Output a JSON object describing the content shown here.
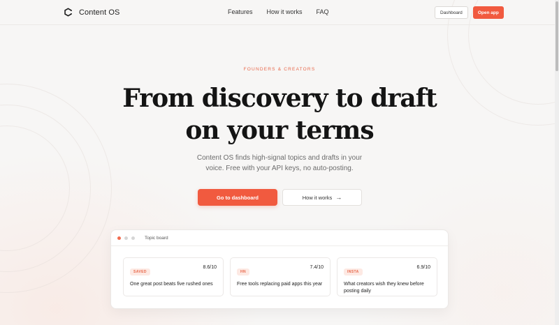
{
  "header": {
    "brand": "Content OS",
    "nav": [
      "Features",
      "How it works",
      "FAQ"
    ],
    "dashboard_label": "Dashboard",
    "open_app_label": "Open app"
  },
  "hero": {
    "eyebrow": "FOUNDERS & CREATORS",
    "headline_line1": "From discovery to draft",
    "headline_line2": "on your terms",
    "subtitle": "Content OS finds high-signal topics and drafts in your voice. Free with your API keys, no auto-posting.",
    "cta_primary": "Go to dashboard",
    "cta_secondary": "How it works",
    "cta_secondary_icon": "arrow-right-icon"
  },
  "board": {
    "title": "Topic board",
    "window_dots": [
      "#f26b4f",
      "#d6d6d6",
      "#d6d6d6"
    ],
    "cards": [
      {
        "tag": "SAVED",
        "score": "8.6/10",
        "text": "One great post beats five rushed ones"
      },
      {
        "tag": "HN",
        "score": "7.4/10",
        "text": "Free tools replacing paid apps this year"
      },
      {
        "tag": "INSTA",
        "score": "6.9/10",
        "text": "What creators wish they knew before posting daily"
      }
    ]
  },
  "colors": {
    "accent": "#f15a3f",
    "eyebrow": "#e8674a",
    "background": "#f7f6f5"
  }
}
